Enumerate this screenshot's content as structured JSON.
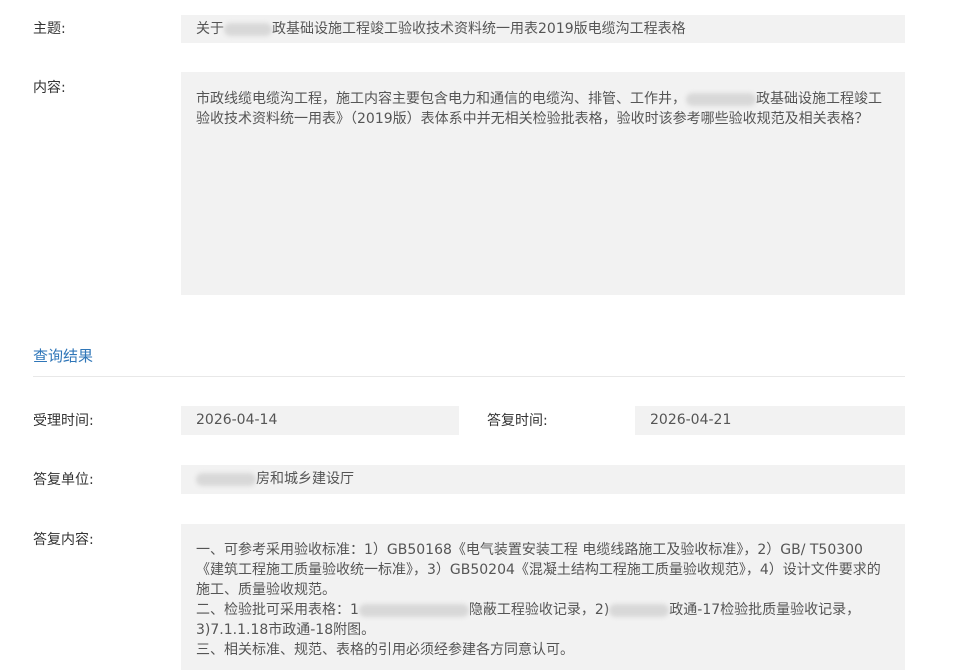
{
  "labels": {
    "subject": "主题:",
    "content": "内容:",
    "accept_time": "受理时间:",
    "reply_time": "答复时间:",
    "reply_unit": "答复单位:",
    "reply_content": "答复内容:"
  },
  "subject": {
    "prefix": "关于",
    "suffix": "政基础设施工程竣工验收技术资料统一用表2019版电缆沟工程表格"
  },
  "content": {
    "part1": "市政线缆电缆沟工程，施工内容主要包含电力和通信的电缆沟、排管、工作井，",
    "part2": "政基础设施工程竣工验收技术资料统一用表》（2019版）表体系中并无相关检验批表格，验收时该参考哪些验收规范及相关表格？"
  },
  "section_title": "查询结果",
  "accept_time": "2026-04-14",
  "reply_time": "2026-04-21",
  "reply_unit": {
    "suffix": "房和城乡建设厅"
  },
  "reply_content": {
    "line1": "一、可参考采用验收标准：1）GB50168《电气装置安装工程 电缆线路施工及验收标准》，2）GB/ T50300《建筑工程施工质量验收统一标准》，3）GB50204《混凝土结构工程施工质量验收规范》，4）设计文件要求的施工、质量验收规范。",
    "line2_a": "二、检验批可采用表格：1",
    "line2_b": "隐蔽工程验收记录，2)",
    "line2_c": "政通-17检验批质量验收记录，3)7.1.1.18市政通-18附图。",
    "line3": "三、相关标准、规范、表格的引用必须经参建各方同意认可。"
  }
}
